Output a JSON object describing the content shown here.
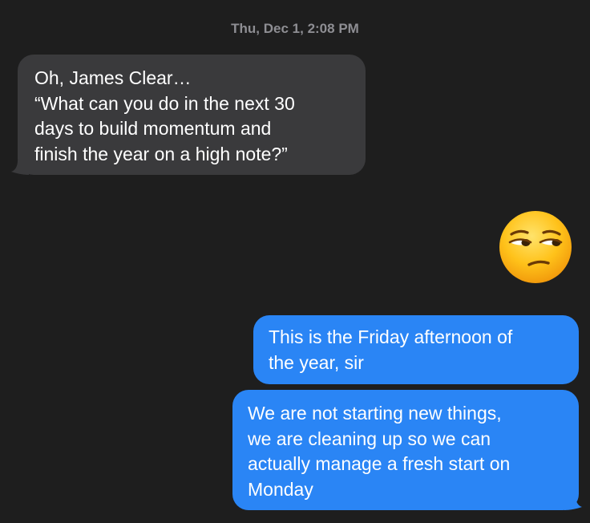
{
  "conversation": {
    "timestamp": "Thu, Dec 1, 2:08 PM",
    "messages": [
      {
        "direction": "incoming",
        "lines": [
          "Oh, James Clear…",
          "“What can you do in the next 30",
          "days to build momentum and",
          "finish the year on a high note?”"
        ]
      },
      {
        "direction": "outgoing",
        "emoji": "unamused-face-icon"
      },
      {
        "direction": "outgoing",
        "lines": [
          "This is the Friday afternoon of",
          "the year, sir"
        ]
      },
      {
        "direction": "outgoing",
        "lines": [
          "We are not starting new things,",
          "we are cleaning up so we can",
          "actually manage a fresh start on",
          "Monday"
        ]
      }
    ]
  },
  "colors": {
    "background": "#1e1e1e",
    "incoming_bubble": "#3a3a3c",
    "outgoing_bubble": "#2a85f5",
    "timestamp_text": "#8e8e93",
    "message_text": "#ffffff"
  }
}
